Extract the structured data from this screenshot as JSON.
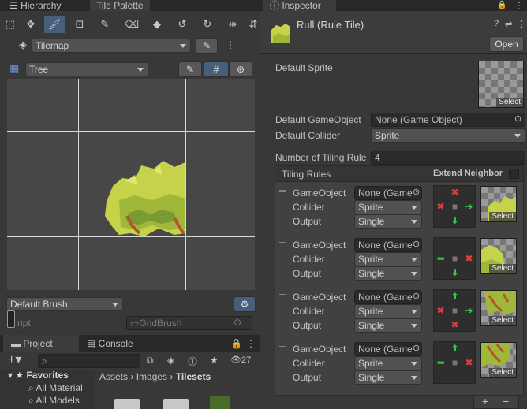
{
  "left": {
    "tabs": {
      "hierarchy": "Hierarchy",
      "tile_palette": "Tile Palette"
    },
    "tilemap_dropdown": "Tilemap",
    "palette_dropdown": "Tree",
    "brush_dropdown": "Default Brush",
    "script_label": "ript",
    "script_value": "GridBrush"
  },
  "bottom": {
    "tabs": {
      "project": "Project",
      "console": "Console"
    },
    "add_label": "+",
    "badge_count": "27",
    "favorites": "Favorites",
    "fav_items": [
      "All Material",
      "All Models"
    ],
    "breadcrumb": {
      "part1": "Assets",
      "part2": "Images",
      "part3": "Tilesets"
    }
  },
  "inspector": {
    "tab": "Inspector",
    "title": "Rull (Rule Tile)",
    "open_button": "Open",
    "default_sprite_label": "Default Sprite",
    "default_gameobject_label": "Default GameObject",
    "default_gameobject_value": "None (Game Object)",
    "default_collider_label": "Default Collider",
    "default_collider_value": "Sprite",
    "num_rules_label": "Number of Tiling Rule",
    "num_rules_value": "4",
    "tiling_rules_label": "Tiling Rules",
    "extend_neighbor_label": "Extend Neighbor",
    "select_label": "Select",
    "row_labels": {
      "gameobject": "GameObject",
      "collider": "Collider",
      "output": "Output"
    },
    "rules": [
      {
        "gameobject": "None (Game",
        "collider": "Sprite",
        "output": "Single"
      },
      {
        "gameobject": "None (Game",
        "collider": "Sprite",
        "output": "Single"
      },
      {
        "gameobject": "None (Game",
        "collider": "Sprite",
        "output": "Single"
      },
      {
        "gameobject": "None (Game",
        "collider": "Sprite",
        "output": "Single"
      }
    ],
    "footer": {
      "add": "+",
      "remove": "−"
    }
  },
  "colors": {
    "accent": "#46607c",
    "green": "#2ecc40",
    "red": "#e23c3c"
  }
}
